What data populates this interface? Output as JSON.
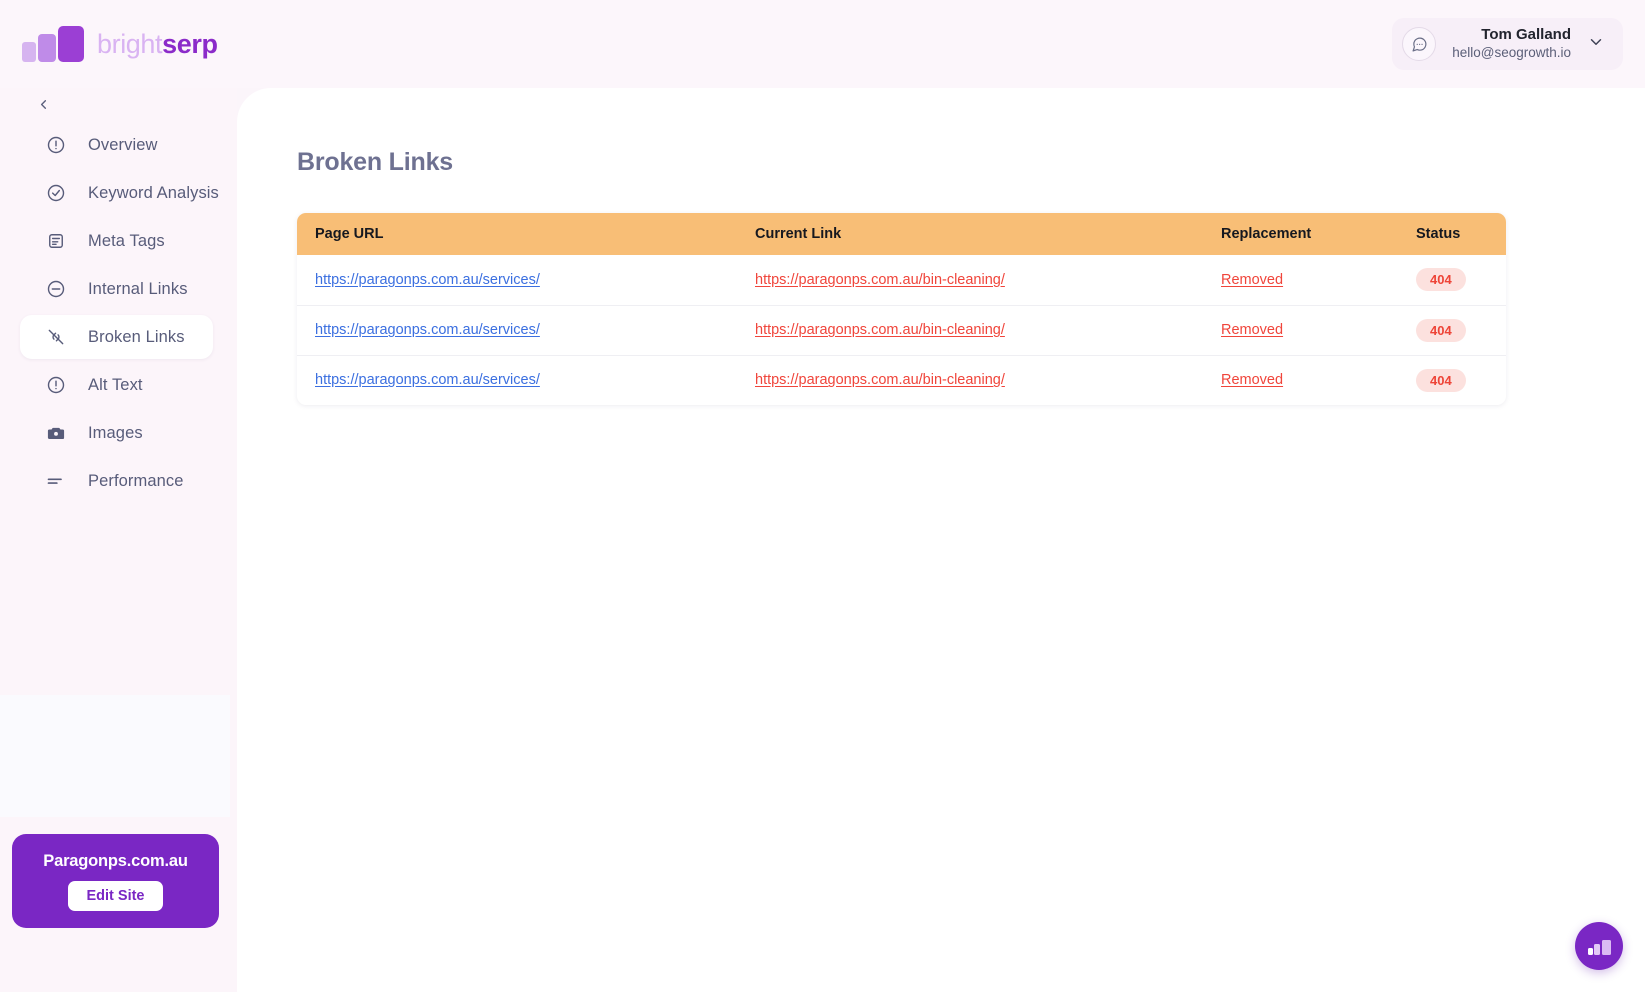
{
  "brand": {
    "name_light": "bright",
    "name_bold": "serp",
    "logo_icon": "bar-chart-logo"
  },
  "header": {
    "avatar_icon": "chat-bubble-icon",
    "user_name": "Tom Galland",
    "user_email": "hello@seogrowth.io",
    "chevron_icon": "chevron-down-icon"
  },
  "sidebar": {
    "collapse_icon": "chevron-left-icon",
    "items": [
      {
        "label": "Overview",
        "icon": "alert-circle-icon",
        "active": false
      },
      {
        "label": "Keyword Analysis",
        "icon": "check-circle-icon",
        "active": false
      },
      {
        "label": "Meta Tags",
        "icon": "clipboard-icon",
        "active": false
      },
      {
        "label": "Internal Links",
        "icon": "minus-circle-icon",
        "active": false
      },
      {
        "label": "Broken Links",
        "icon": "unlink-icon",
        "active": true
      },
      {
        "label": "Alt Text",
        "icon": "alert-circle-icon",
        "active": false
      },
      {
        "label": "Images",
        "icon": "camera-icon",
        "active": false
      },
      {
        "label": "Performance",
        "icon": "sliders-icon",
        "active": false
      }
    ],
    "site_card": {
      "site_name": "Paragonps.com.au",
      "edit_button_label": "Edit Site"
    }
  },
  "main": {
    "page_title": "Broken Links",
    "table": {
      "columns": [
        "Page URL",
        "Current Link",
        "Replacement",
        "Status"
      ],
      "rows": [
        {
          "page_url": "https://paragonps.com.au/services/",
          "current_link": "https://paragonps.com.au/bin-cleaning/",
          "replacement": "Removed",
          "status": "404"
        },
        {
          "page_url": "https://paragonps.com.au/services/",
          "current_link": "https://paragonps.com.au/bin-cleaning/",
          "replacement": "Removed",
          "status": "404"
        },
        {
          "page_url": "https://paragonps.com.au/services/",
          "current_link": "https://paragonps.com.au/bin-cleaning/",
          "replacement": "Removed",
          "status": "404"
        }
      ]
    }
  },
  "fab": {
    "icon": "bar-chart-logo"
  },
  "colors": {
    "brand_purple": "#7A27C4",
    "brand_purple_light": "#D9B3F2",
    "table_header_orange": "#F8BE76",
    "link_blue": "#3B6FE0",
    "link_red": "#F0453B",
    "badge_bg": "#FCE1DE",
    "badge_text": "#EE4437",
    "sidebar_bg": "#FCF5FA",
    "title_gray": "#6E7191"
  }
}
